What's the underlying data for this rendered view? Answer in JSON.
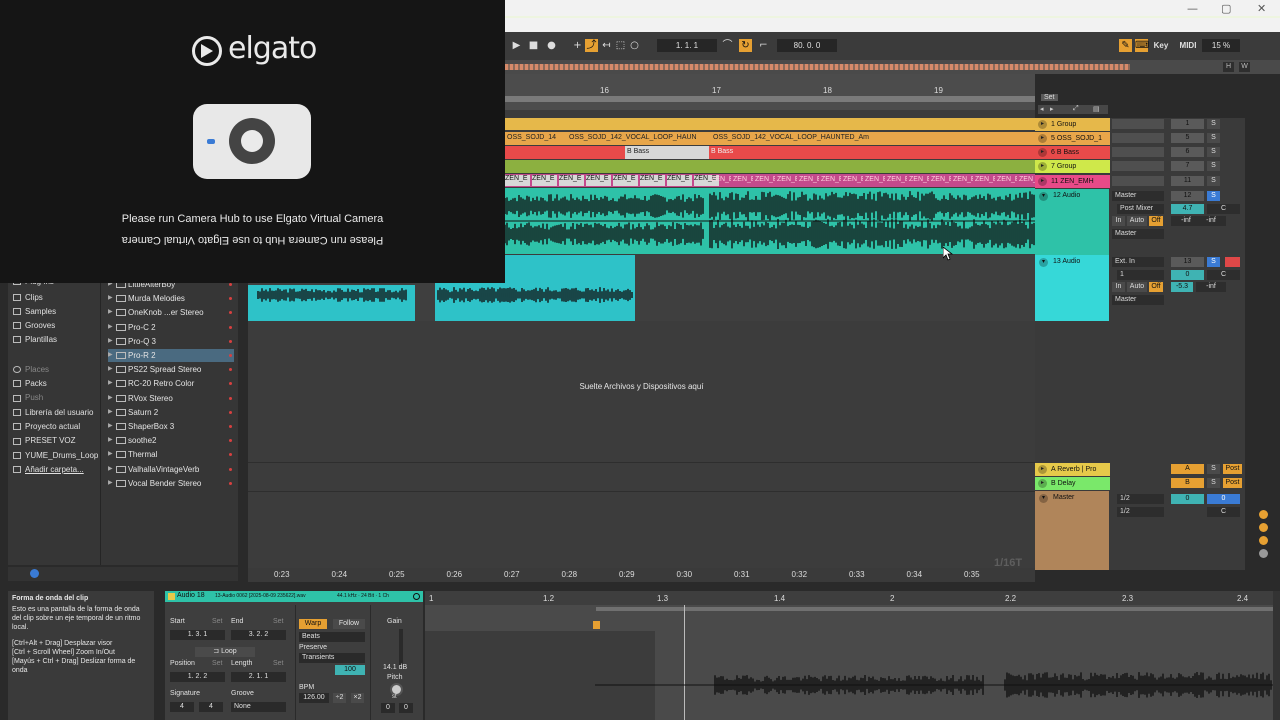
{
  "window": {
    "minimize": "—",
    "maximize": "▢",
    "close": "✕"
  },
  "transport": {
    "position": "1.   1.   1",
    "tempo_field": "80.   0.   0",
    "key_label": "Key",
    "midi_label": "MIDI",
    "zoom": "15 %"
  },
  "overview": {
    "h_label": "H",
    "w_label": "W"
  },
  "ruler": {
    "bars": [
      "16",
      "17",
      "18",
      "19"
    ],
    "set_label": "Set"
  },
  "elgato": {
    "logo_text": "elgato",
    "message": "Please run Camera Hub to use Elgato Virtual Camera",
    "message_mirrored": "Please run Camera Hub to use Elgato Virtual Camera"
  },
  "clips": {
    "vocal_loop_a": "OSS_SOJD_14",
    "vocal_loop_b": "OSS_SOJD_142_VOCAL_LOOP_HAUN",
    "vocal_loop_c": "OSS_SOJD_142_VOCAL_LOOP_HAUNTED_Am",
    "bass_a": "B Bass",
    "bass_b": "B Bass",
    "zen": [
      "ZEN_E",
      "ZEN_E",
      "ZEN_E",
      "ZEN_E",
      "ZEN_E",
      "ZEN_E",
      "ZEN_E",
      "ZEN_E"
    ],
    "zen_red": [
      "ZEN_E",
      "ZEN_E",
      "ZEN_E",
      "ZEN_E",
      "ZEN_E",
      "ZEN_E",
      "ZEN_E",
      "ZEN_E",
      "ZEN_E",
      "ZEN_E",
      "ZEN_E",
      "ZEN_E",
      "ZEN_E",
      "ZEN_E",
      "ZEN_E"
    ],
    "drop_hint": "Suelte Archivos y Dispositivos aquí"
  },
  "tracks": [
    {
      "name": "1 Group",
      "color": "#e6b84a",
      "num": "1"
    },
    {
      "name": "5 OSS_SOJD_1",
      "color": "#e8a64a",
      "num": "5"
    },
    {
      "name": "6 B Bass",
      "color": "#e84a4a",
      "num": "6"
    },
    {
      "name": "7 Group",
      "color": "#cfe84a",
      "num": "7"
    },
    {
      "name": "11 ZEN_EMH",
      "color": "#e84a88",
      "num": "11"
    }
  ],
  "audio12": {
    "name": "12 Audio",
    "output": "Master",
    "post": "Post Mixer",
    "num": "12",
    "vol": "4.7",
    "pan": "C",
    "in": "In",
    "auto": "Auto",
    "off": "Off",
    "inf1": "-inf",
    "inf2": "-inf",
    "out2": "Master"
  },
  "audio13": {
    "name": "13 Audio",
    "input": "Ext. In",
    "ch": "1",
    "num": "13",
    "vol": "0",
    "pan": "C",
    "in": "In",
    "auto": "Auto",
    "off": "Off",
    "db": "-5.3",
    "inf": "-inf",
    "output": "Master"
  },
  "returns": [
    {
      "name": "A Reverb | Pro",
      "color": "#e6c94a",
      "letter": "A",
      "post": "Post"
    },
    {
      "name": "B Delay",
      "color": "#7ae86a",
      "letter": "B",
      "post": "Post"
    }
  ],
  "master": {
    "name": "Master",
    "io1": "1/2",
    "io2": "1/2",
    "vol": "0",
    "vol2": "0",
    "pan": "C"
  },
  "mixer_s": "S",
  "browser": {
    "categories": [
      "Plug-ins",
      "Clips",
      "Samples",
      "Grooves",
      "Plantillas"
    ],
    "places_header": "Places",
    "places": [
      "Packs",
      "Push",
      "Librería del usuario",
      "Proyecto actual",
      "PRESET VOZ",
      "YUME_Drums_Loop",
      "Añadir carpeta..."
    ],
    "plugins": [
      "LittleAlterBoy",
      "Murda Melodies",
      "OneKnob ...er Stereo",
      "Pro-C 2",
      "Pro-Q 3",
      "Pro-R 2",
      "PS22 Spread Stereo",
      "RC-20 Retro Color",
      "RVox Stereo",
      "Saturn 2",
      "ShaperBox 3",
      "soothe2",
      "Thermal",
      "ValhallaVintageVerb",
      "Vocal Bender Stereo"
    ],
    "selected_plugin": "Pro-R 2"
  },
  "timeline": [
    "0:23",
    "0:24",
    "0:25",
    "0:26",
    "0:27",
    "0:28",
    "0:29",
    "0:30",
    "0:31",
    "0:32",
    "0:33",
    "0:34",
    "0:35"
  ],
  "grid_label": "1/16T",
  "info": {
    "title": "Forma de onda del clip",
    "body": "Esto es una pantalla de la forma de onda del clip sobre un eje temporal de un ritmo local.",
    "shortcuts": [
      "[Ctrl+Alt + Drag] Desplazar visor",
      "[Ctrl + Scroll Wheel] Zoom In/Out",
      "[Mayús + Ctrl + Drag] Deslizar forma de onda"
    ]
  },
  "clip": {
    "name": "Audio 18",
    "file": "13-Audio 0062 [2025-08-09 235622].wav",
    "format": "44.1 kHz · 24 Bit · 1 Ch",
    "start_label": "Start",
    "end_label": "End",
    "set": "Set",
    "start": [
      "1.",
      "3.",
      "1"
    ],
    "end": [
      "3.",
      "2.",
      "2"
    ],
    "loop_label": "Loop",
    "position_label": "Position",
    "length_label": "Length",
    "position": [
      "1.",
      "2.",
      "2"
    ],
    "length": [
      "2.",
      "1.",
      "1"
    ],
    "signature_label": "Signature",
    "groove_label": "Groove",
    "sig_num": "4",
    "sig_den": "4",
    "groove": "None",
    "warp": "Warp",
    "follow": "Follow",
    "mode": "Beats",
    "preserve_label": "Preserve",
    "preserve": "Transients",
    "preserve_val": "100",
    "bpm_label": "BPM",
    "bpm": "126.00",
    "half": "÷2",
    "double": "×2",
    "gain_label": "Gain",
    "gain": "14.1 dB",
    "pitch_label": "Pitch",
    "st": "st",
    "pitch": "0",
    "detune": "0"
  },
  "sample_ruler": [
    "1",
    "1.2",
    "1.3",
    "1.4",
    "2",
    "2.2",
    "2.3",
    "2.4"
  ]
}
